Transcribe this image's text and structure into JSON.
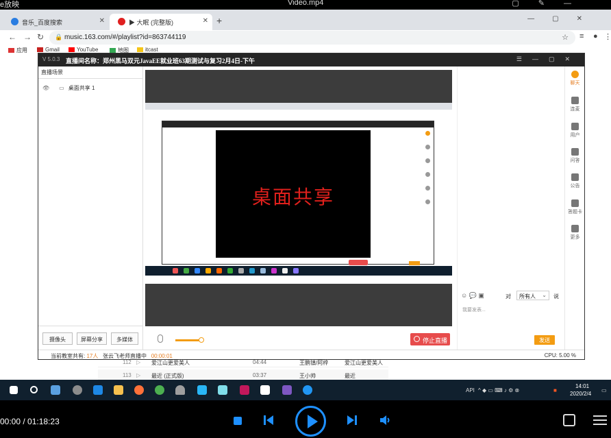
{
  "player": {
    "top_left": "e放映",
    "title": "Video.mp4",
    "timecode": "00:00 / 01:18:23"
  },
  "browser": {
    "tab1_title": "音乐_百度搜索",
    "tab2_title": "▶ 大眠 (完整版)",
    "url": "music.163.com/#/playlist?id=863744119",
    "bookmarks": [
      "应用",
      "Gmail",
      "YouTube",
      "地图",
      "itcast"
    ]
  },
  "playlist_rows": [
    {
      "num": "112",
      "song": "爱江山更爱美人",
      "duration": "04:44",
      "artist": "王鹏镇/阿梓",
      "album": "爱江山更爱美人"
    },
    {
      "num": "113",
      "song": "最近 (正式版)",
      "duration": "03:37",
      "artist": "王小帅",
      "album": "最近"
    }
  ],
  "app": {
    "version": "V 5.0.3",
    "room_name": "直播间名称：郑州黑马双元JavaEE就业班63期测试与复习2月4日-下午",
    "scenes_title": "直播场景",
    "scene_item": "桌面共享 1",
    "buttons": {
      "camera": "摄像头",
      "screen_share": "屏幕分享",
      "media": "多媒体"
    },
    "desktop_share_text": "桌面共享",
    "stop_live": "停止直播",
    "chat": {
      "to": "对",
      "recipient": "所有人",
      "say": "说",
      "placeholder": "我要发表...",
      "send": "发送"
    },
    "side": [
      "聊天",
      "连麦",
      "用户",
      "问答",
      "公告",
      "答题卡",
      "更多"
    ],
    "status": {
      "online_label": "当前教室共有:",
      "online_count": "17人",
      "host_label": "张云飞老师直播中",
      "elapsed": "00:00:01",
      "cpu": "CPU: 5.00 %"
    }
  },
  "taskbar": {
    "api": "API",
    "time": "14:01",
    "date": "2020/2/4"
  }
}
